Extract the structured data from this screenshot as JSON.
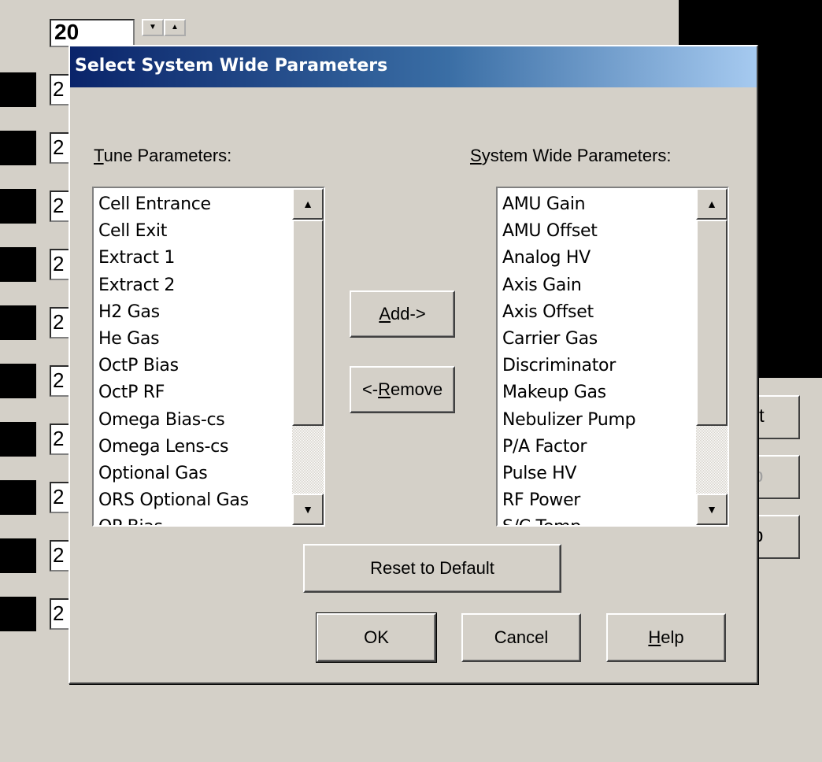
{
  "background": {
    "spin_value": "20",
    "row_values": [
      "2",
      "2",
      "2",
      "2",
      "2",
      "2",
      "2",
      "2",
      "2",
      "2"
    ],
    "right_buttons": [
      "rt",
      "p",
      "p"
    ]
  },
  "dialog": {
    "title": "Select System Wide Parameters",
    "tune_label": "Tune Parameters:",
    "system_label": "System Wide Parameters:",
    "tune_items": [
      "Cell Entrance",
      "Cell Exit",
      "Extract 1",
      "Extract 2",
      "H2 Gas",
      "He Gas",
      "OctP Bias",
      "OctP RF",
      "Omega Bias-cs",
      "Omega Lens-cs",
      "Optional Gas",
      "ORS Optional Gas",
      "QP Bias"
    ],
    "system_items": [
      "AMU Gain",
      "AMU Offset",
      "Analog HV",
      "Axis Gain",
      "Axis Offset",
      "Carrier Gas",
      "Discriminator",
      "Makeup Gas",
      "Nebulizer Pump",
      "P/A Factor",
      "Pulse HV",
      "RF Power",
      "S/C Temp"
    ],
    "add_button": "Add->",
    "remove_button": "<-Remove",
    "reset_button": "Reset to Default",
    "ok_button": "OK",
    "cancel_button": "Cancel",
    "help_button": "Help"
  },
  "icons": {
    "scroll_up": "▲",
    "scroll_down": "▼",
    "spin_down": "▼",
    "spin_up": "▲"
  }
}
